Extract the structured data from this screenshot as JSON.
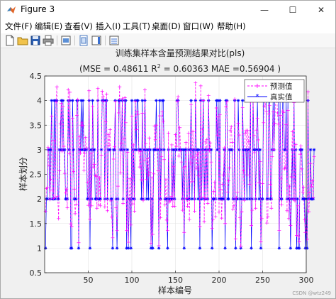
{
  "window": {
    "title": "Figure 3",
    "minimize": "—",
    "maximize": "☐",
    "close": "✕"
  },
  "menu": [
    "文件(F)",
    "编辑(E)",
    "查看(V)",
    "插入(I)",
    "工具(T)",
    "桌面(D)",
    "窗口(W)",
    "帮助(H)"
  ],
  "toolbar_icons": [
    "new-figure-icon",
    "open-file-icon",
    "save-icon",
    "print-icon",
    "print-preview-icon",
    "link-figure-icon",
    "insert-colorbar-icon",
    "insert-legend-icon"
  ],
  "watermark": "CSDN @wtz249",
  "chart_data": {
    "type": "line",
    "title": "训练集样本含量预测结果对比(pls)",
    "subtitle": {
      "prefix": "(MSE = 0.48611 R",
      "sup": "2",
      "suffix": " = 0.60363 MAE =0.56904 )"
    },
    "xlabel": "样本编号",
    "ylabel": "样本划分",
    "xlim": [
      0,
      300
    ],
    "ylim": [
      0.5,
      4.5
    ],
    "xticks": [
      50,
      100,
      150,
      200,
      250,
      300
    ],
    "yticks": [
      0.5,
      1,
      1.5,
      2,
      2.5,
      3,
      3.5,
      4,
      4.5
    ],
    "grid": true,
    "legend_position": "top-right",
    "series": [
      {
        "name": "预测值",
        "color": "#ff00ff",
        "marker": "+",
        "line": "dashed",
        "values": [
          1.75,
          2.21,
          2.23,
          3.05,
          2.68,
          1.99,
          2.4,
          3.68,
          2.18,
          2.01,
          3.19,
          2.04,
          3.97,
          4.28,
          2.05,
          1.6,
          2.57,
          3.53,
          3.94,
          2.97,
          3.88,
          3.07,
          2.52,
          2.12,
          2.2,
          1.82,
          4.22,
          2.92,
          4.17,
          1.49,
          1.44,
          3.64,
          2.56,
          2.2,
          1.7,
          1.89,
          3.7,
          4.02,
          1.11,
          3.27,
          2.93,
          3.5,
          3.56,
          3.49,
          2.58,
          2.93,
          3.25,
          3.04,
          2.34,
          1.87,
          4.2,
          1.59,
          2.93,
          1.86,
          3.88,
          2.65,
          2.7,
          2.48,
          2.46,
          1.81,
          4.25,
          1.88,
          2.43,
          1.86,
          2.89,
          4.19,
          4.08,
          3.99,
          1.84,
          3.57,
          4.13,
          1.76,
          3.31,
          3.09,
          3.41,
          1.96,
          1.63,
          1.21,
          2.81,
          3.06,
          3.98,
          1.82,
          1.36,
          2.26,
          3.75,
          4.28,
          2.53,
          3.13,
          4.04,
          1.91,
          3.22,
          4.06,
          3.55,
          1.36,
          2.95,
          1.12,
          2.0,
          2.41,
          1.47,
          3.68,
          1.9,
          3.1,
          1.75,
          3.98,
          3.41,
          3.78,
          3.72,
          2.98,
          2.65,
          2.96,
          2.39,
          3.74,
          1.97,
          2.79,
          4.22,
          3.12,
          2.4,
          2.82,
          2.48,
          3.24,
          2.54,
          1.1,
          2.43,
          1.28,
          2.51,
          3.48,
          3.21,
          3.5,
          3.02,
          2.57,
          1.05,
          3.69,
          1.62,
          2.86,
          3.77,
          3.58,
          2.8,
          1.88,
          2.39,
          1.57,
          1.36,
          3.34,
          1.94,
          1.96,
          2.05,
          3.1,
          1.85,
          2.66,
          1.85,
          3.31,
          3.07,
          3.99,
          4.08,
          2.87,
          3.45,
          2.98,
          2.75,
          1.77,
          2.64,
          1.32,
          2.66,
          3.15,
          2.01,
          1.85,
          3.34,
          1.58,
          2.73,
          3.92,
          2.35,
          3.37,
          2.85,
          1.75,
          4.36,
          2.62,
          2.91,
          2.47,
          2.94,
          1.44,
          4.3,
          2.04,
          3.42,
          4.0,
          1.54,
          3.16,
          2.01,
          3.21,
          1.91,
          4.1,
          2.98,
          3.14,
          2.75,
          1.4,
          1.58,
          2.15,
          2.34,
          1.64,
          3.85,
          3.29,
          3.67,
          1.73,
          3.71,
          2.19,
          1.61,
          2.3,
          2.49,
          3.04,
          1.5,
          3.87,
          3.98,
          2.14,
          2.37,
          2.63,
          3.39,
          3.47,
          3.15,
          1.79,
          1.86,
          4.03,
          1.19,
          2.02,
          2.14,
          3.54,
          3.3,
          1.62,
          1.04,
          1.74,
          3.86,
          2.57,
          1.97,
          3.33,
          3.39,
          2.49,
          3.39,
          3.17,
          2.3,
          3.97,
          1.46,
          1.77,
          4.11,
          3.29,
          2.94,
          1.81,
          3.4,
          3.64,
          3.2,
          2.33,
          2.76,
          1.13,
          1.6,
          2.31,
          3.55,
          3.89,
          4.01,
          3.78,
          1.51,
          1.64,
          3.73,
          3.9,
          2.3,
          1.81,
          2.86,
          3.77,
          3.0,
          3.54,
          4.34,
          4.2,
          3.75,
          3.52,
          1.36,
          3.7,
          2.42,
          1.88,
          3.79,
          3.76,
          2.61,
          2.64,
          3.51,
          1.76,
          3.8,
          1.6,
          2.26,
          1.46,
          2.45,
          3.37,
          2.0,
          3.96,
          1.96,
          3.11,
          1.26,
          1.86,
          1.25,
          1.13,
          2.91,
          3.08,
          2.61,
          2.14,
          2.24,
          1.58,
          1.32,
          1.58,
          1.18,
          4.18,
          1.74,
          2.13,
          2.72,
          2.25,
          2.37,
          2.03,
          2.86
        ]
      },
      {
        "name": "真实值",
        "color": "#0000ff",
        "marker": "*",
        "line": "solid",
        "values": [
          1,
          2,
          2,
          3,
          3,
          2,
          3,
          4,
          2,
          2,
          4,
          2,
          4,
          4,
          2,
          2,
          3,
          3,
          4,
          3,
          4,
          3,
          3,
          2,
          2,
          2,
          4,
          3,
          4,
          1,
          1,
          4,
          3,
          2,
          2,
          2,
          4,
          4,
          1,
          3,
          3,
          4,
          3,
          4,
          3,
          3,
          3,
          3,
          2,
          2,
          4,
          1,
          3,
          2,
          4,
          3,
          3,
          2,
          2,
          2,
          4,
          2,
          2,
          2,
          3,
          4,
          4,
          4,
          2,
          4,
          4,
          2,
          3,
          3,
          3,
          2,
          2,
          1,
          3,
          3,
          4,
          2,
          1,
          2,
          4,
          4,
          3,
          3,
          4,
          2,
          3,
          4,
          4,
          1,
          3,
          1,
          2,
          2,
          1,
          4,
          2,
          3,
          2,
          4,
          3,
          4,
          4,
          3,
          3,
          3,
          2,
          4,
          2,
          3,
          4,
          3,
          2,
          3,
          2,
          3,
          3,
          1,
          2,
          1,
          3,
          3,
          3,
          4,
          3,
          3,
          1,
          4,
          2,
          3,
          4,
          4,
          3,
          2,
          2,
          2,
          1,
          3,
          2,
          2,
          2,
          3,
          2,
          3,
          2,
          3,
          3,
          4,
          4,
          3,
          3,
          3,
          3,
          2,
          3,
          1,
          3,
          3,
          2,
          2,
          3,
          2,
          3,
          4,
          2,
          3,
          3,
          2,
          4,
          3,
          3,
          2,
          3,
          1,
          4,
          2,
          3,
          4,
          2,
          3,
          2,
          3,
          2,
          4,
          3,
          3,
          3,
          1,
          2,
          2,
          2,
          2,
          4,
          3,
          4,
          2,
          4,
          2,
          2,
          2,
          2,
          3,
          1,
          4,
          4,
          2,
          2,
          3,
          3,
          3,
          3,
          2,
          2,
          4,
          1,
          2,
          2,
          4,
          3,
          2,
          1,
          2,
          4,
          3,
          2,
          3,
          3,
          2,
          3,
          3,
          2,
          4,
          1,
          2,
          4,
          3,
          3,
          2,
          3,
          4,
          3,
          2,
          3,
          1,
          2,
          2,
          4,
          4,
          4,
          4,
          2,
          2,
          4,
          4,
          2,
          2,
          3,
          4,
          3,
          4,
          4,
          4,
          4,
          4,
          1,
          4,
          2,
          2,
          4,
          4,
          3,
          3,
          4,
          2,
          4,
          2,
          2,
          1,
          2,
          3,
          2,
          4,
          2,
          3,
          1,
          2,
          1,
          1,
          3,
          3,
          3,
          2,
          2,
          2,
          1,
          2,
          1,
          4,
          2,
          2,
          3,
          2,
          2,
          2,
          3
        ]
      }
    ]
  }
}
